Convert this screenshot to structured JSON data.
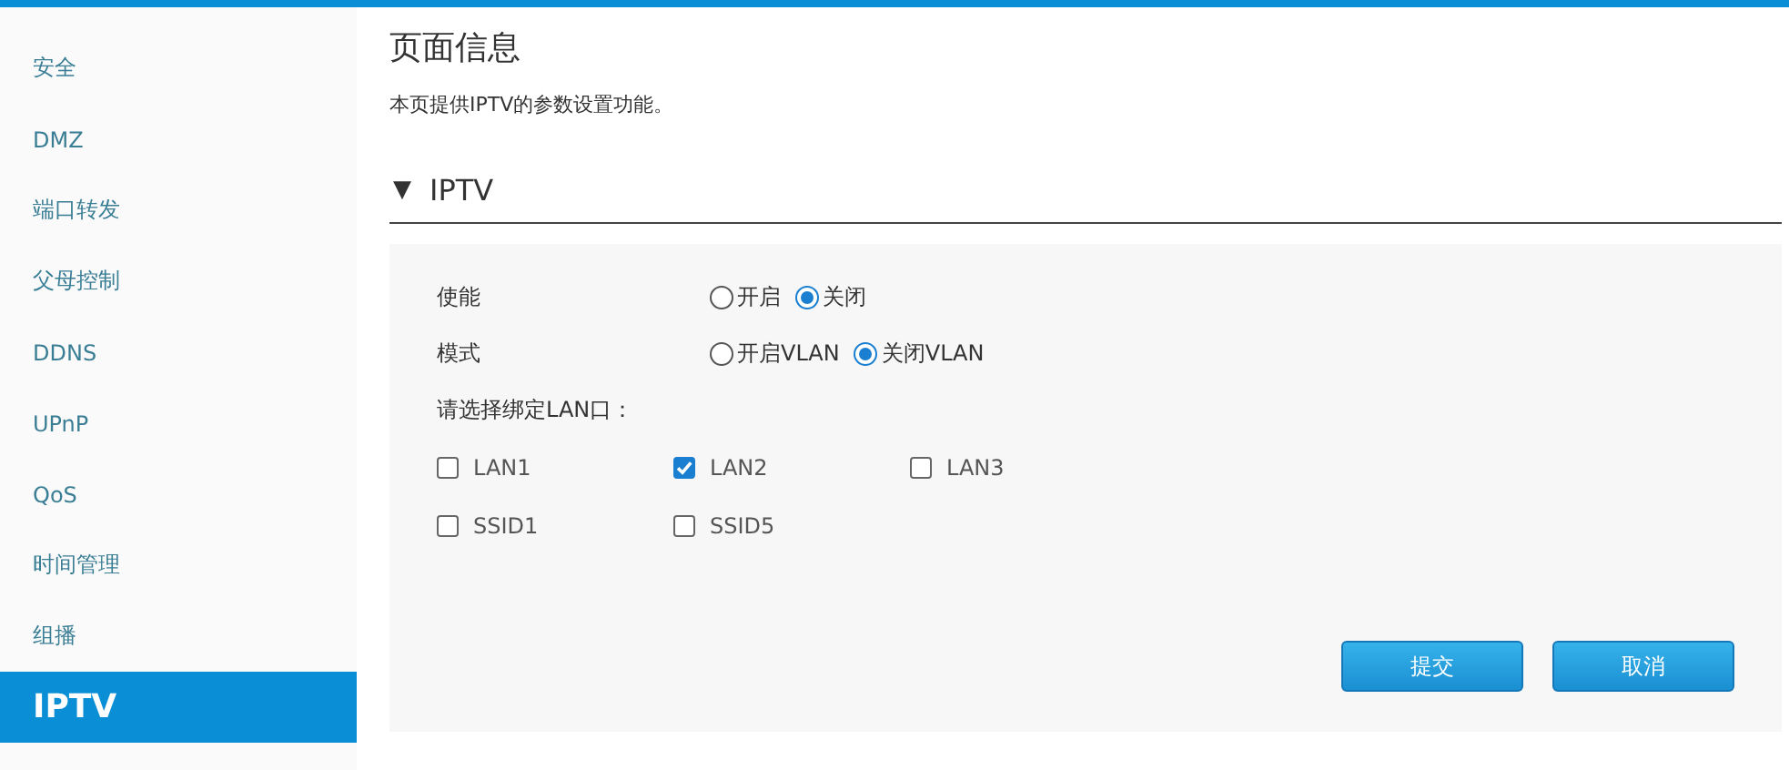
{
  "sidebar": {
    "items": [
      {
        "label": "安全",
        "selected": false
      },
      {
        "label": "DMZ",
        "selected": false
      },
      {
        "label": "端口转发",
        "selected": false
      },
      {
        "label": "父母控制",
        "selected": false
      },
      {
        "label": "DDNS",
        "selected": false
      },
      {
        "label": "UPnP",
        "selected": false
      },
      {
        "label": "QoS",
        "selected": false
      },
      {
        "label": "时间管理",
        "selected": false
      },
      {
        "label": "组播",
        "selected": false
      },
      {
        "label": "IPTV",
        "selected": true
      }
    ]
  },
  "page": {
    "title": "页面信息",
    "description": "本页提供IPTV的参数设置功能。"
  },
  "section": {
    "toggle": "▼",
    "title": "IPTV",
    "expanded": true,
    "radio_rows": [
      {
        "label": "使能",
        "options": [
          {
            "label": "开启",
            "selected": false
          },
          {
            "label": "关闭",
            "selected": true
          }
        ]
      },
      {
        "label": "模式",
        "options": [
          {
            "label": "开启VLAN",
            "selected": false
          },
          {
            "label": "关闭VLAN",
            "selected": true
          }
        ]
      }
    ],
    "lan_prompt": "请选择绑定LAN口：",
    "ports": [
      [
        {
          "label": "LAN1",
          "checked": false
        },
        {
          "label": "LAN2",
          "checked": true
        },
        {
          "label": "LAN3",
          "checked": false
        }
      ],
      [
        {
          "label": "SSID1",
          "checked": false
        },
        {
          "label": "SSID5",
          "checked": false
        }
      ]
    ],
    "buttons": [
      "提交",
      "取消"
    ]
  }
}
